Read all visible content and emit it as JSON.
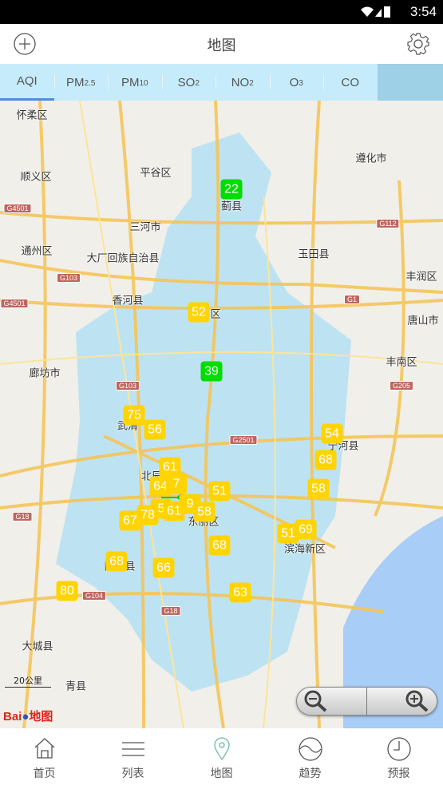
{
  "status_bar": {
    "time": "3:54"
  },
  "header": {
    "title": "地图",
    "add_icon": "plus-circle-icon",
    "settings_icon": "gear-icon"
  },
  "tabs": [
    {
      "label": "AQI",
      "active": true
    },
    {
      "label": "PM",
      "sub": "2.5"
    },
    {
      "label": "PM",
      "sub": "10"
    },
    {
      "label": "SO",
      "sub": "2"
    },
    {
      "label": "NO",
      "sub": "2"
    },
    {
      "label": "O",
      "sub": "3"
    },
    {
      "label": "CO"
    }
  ],
  "colors": {
    "good": "#00dd00",
    "moderate": "#ffd400",
    "tab_bg": "#c6ebfa",
    "region": "#bde3f2",
    "sea": "#a8cdf6"
  },
  "places": [
    "怀柔区",
    "顺义区",
    "平谷区",
    "遵化市",
    "蓟县",
    "三河市",
    "通州区",
    "大厂回族自治县",
    "玉田县",
    "丰润区",
    "香河县",
    "区",
    "唐山市",
    "丰南区",
    "廊坊市",
    "武清",
    "北辰",
    "东丽区",
    "滨海新区",
    "静海县",
    "宁河县",
    "大城县",
    "青县"
  ],
  "road_shields": [
    "G4501",
    "G112",
    "G103",
    "G4501",
    "G1",
    "G103",
    "G2501",
    "G205",
    "G18",
    "G104",
    "G18"
  ],
  "markers": [
    {
      "value": "22",
      "level": "good"
    },
    {
      "value": "52",
      "level": "moderate"
    },
    {
      "value": "39",
      "level": "good"
    },
    {
      "value": "75",
      "level": "moderate"
    },
    {
      "value": "56",
      "level": "moderate"
    },
    {
      "value": "54",
      "level": "moderate"
    },
    {
      "value": "68",
      "level": "moderate"
    },
    {
      "value": "61",
      "level": "moderate"
    },
    {
      "value": "58",
      "level": "moderate"
    },
    {
      "value": "64",
      "level": "moderate"
    },
    {
      "value": "7",
      "level": "moderate"
    },
    {
      "value": "51",
      "level": "moderate"
    },
    {
      "value": "9",
      "level": "moderate"
    },
    {
      "value": "5",
      "level": "moderate"
    },
    {
      "value": "61",
      "level": "moderate"
    },
    {
      "value": "58",
      "level": "moderate"
    },
    {
      "value": "78",
      "level": "moderate"
    },
    {
      "value": "67",
      "level": "moderate"
    },
    {
      "value": "51",
      "level": "moderate"
    },
    {
      "value": "69",
      "level": "moderate"
    },
    {
      "value": "68",
      "level": "moderate"
    },
    {
      "value": "68",
      "level": "moderate"
    },
    {
      "value": "66",
      "level": "moderate"
    },
    {
      "value": "80",
      "level": "moderate"
    },
    {
      "value": "63",
      "level": "moderate"
    }
  ],
  "map": {
    "scale": "20公里",
    "logo": "Baidu地图",
    "zoom_out_icon": "zoom-out-icon",
    "zoom_in_icon": "zoom-in-icon"
  },
  "nav": [
    {
      "label": "首页",
      "icon": "home-icon"
    },
    {
      "label": "列表",
      "icon": "list-icon"
    },
    {
      "label": "地图",
      "icon": "map-pin-icon",
      "active": true
    },
    {
      "label": "趋势",
      "icon": "trend-icon"
    },
    {
      "label": "预报",
      "icon": "clock-icon"
    }
  ]
}
